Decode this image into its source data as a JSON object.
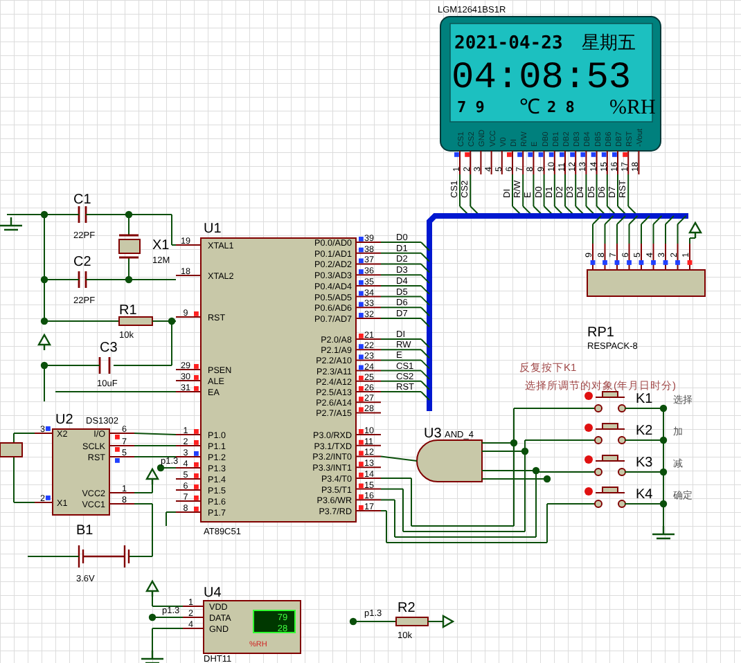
{
  "lcd": {
    "ref": "LGM12641BS1R",
    "date": "2021-04-23",
    "weekday": "星期五",
    "time": "04:08:53",
    "humidity": "7 9",
    "temperature_unit": "℃",
    "temperature": "2 8",
    "humidity_unit": "%RH",
    "pins": [
      {
        "number": "1",
        "name": "CS1",
        "net": "CS1",
        "high": false
      },
      {
        "number": "2",
        "name": "CS2",
        "net": "CS2",
        "high": true
      },
      {
        "number": "3",
        "name": "GND"
      },
      {
        "number": "4",
        "name": "VCC"
      },
      {
        "number": "5",
        "name": "V0"
      },
      {
        "number": "6",
        "name": "DI",
        "net": "DI",
        "high": true
      },
      {
        "number": "7",
        "name": "R/W",
        "net": "R/W",
        "high": false
      },
      {
        "number": "8",
        "name": "E",
        "net": "E",
        "high": false
      },
      {
        "number": "9",
        "name": "DB0",
        "net": "D0",
        "high": false
      },
      {
        "number": "10",
        "name": "DB1",
        "net": "D1",
        "high": false
      },
      {
        "number": "11",
        "name": "DB2",
        "net": "D2",
        "high": false
      },
      {
        "number": "12",
        "name": "DB3",
        "net": "D3",
        "high": false
      },
      {
        "number": "13",
        "name": "DB4",
        "net": "D4",
        "high": false
      },
      {
        "number": "14",
        "name": "DB5",
        "net": "D5",
        "high": false
      },
      {
        "number": "15",
        "name": "DB6",
        "net": "D6",
        "high": false
      },
      {
        "number": "16",
        "name": "DB7",
        "net": "D7",
        "high": false
      },
      {
        "number": "17",
        "name": "RST",
        "net": "RST",
        "high": true
      },
      {
        "number": "18",
        "name": "-Vout"
      }
    ]
  },
  "u1": {
    "ref": "U1",
    "part": "AT89C51",
    "left_pins": [
      {
        "number": "19",
        "name": "XTAL1"
      },
      {
        "number": "18",
        "name": "XTAL2"
      },
      {
        "number": "9",
        "name": "RST",
        "high": true
      },
      {
        "number": "29",
        "name": "PSEN",
        "high": true
      },
      {
        "number": "30",
        "name": "ALE",
        "high": true
      },
      {
        "number": "31",
        "name": "EA",
        "high": true
      },
      {
        "number": "1",
        "name": "P1.0",
        "high": true
      },
      {
        "number": "2",
        "name": "P1.1",
        "high": true
      },
      {
        "number": "3",
        "name": "P1.2",
        "high": false
      },
      {
        "number": "4",
        "name": "P1.3",
        "high": true
      },
      {
        "number": "5",
        "name": "P1.4",
        "high": true
      },
      {
        "number": "6",
        "name": "P1.5",
        "high": true
      },
      {
        "number": "7",
        "name": "P1.6",
        "high": true
      },
      {
        "number": "8",
        "name": "P1.7",
        "high": true
      }
    ],
    "right_pins": [
      {
        "number": "39",
        "name": "P0.0/AD0",
        "net": "D0",
        "high": false
      },
      {
        "number": "38",
        "name": "P0.1/AD1",
        "net": "D1",
        "high": false
      },
      {
        "number": "37",
        "name": "P0.2/AD2",
        "net": "D2",
        "high": false
      },
      {
        "number": "36",
        "name": "P0.3/AD3",
        "net": "D3",
        "high": false
      },
      {
        "number": "35",
        "name": "P0.4/AD4",
        "net": "D4",
        "high": false
      },
      {
        "number": "34",
        "name": "P0.5/AD5",
        "net": "D5",
        "high": false
      },
      {
        "number": "33",
        "name": "P0.6/AD6",
        "net": "D6",
        "high": false
      },
      {
        "number": "32",
        "name": "P0.7/AD7",
        "net": "D7",
        "high": false
      },
      {
        "number": "21",
        "name": "P2.0/A8",
        "net": "DI",
        "high": true
      },
      {
        "number": "22",
        "name": "P2.1/A9",
        "net": "RW",
        "high": false
      },
      {
        "number": "23",
        "name": "P2.2/A10",
        "net": "E",
        "high": false
      },
      {
        "number": "24",
        "name": "P2.3/A11",
        "net": "CS1",
        "high": false
      },
      {
        "number": "25",
        "name": "P2.4/A12",
        "net": "CS2",
        "high": true
      },
      {
        "number": "26",
        "name": "P2.5/A13",
        "net": "RST",
        "high": true
      },
      {
        "number": "27",
        "name": "P2.6/A14",
        "high": true
      },
      {
        "number": "28",
        "name": "P2.7/A15",
        "high": true
      },
      {
        "number": "10",
        "name": "P3.0/RXD",
        "high": true
      },
      {
        "number": "11",
        "name": "P3.1/TXD",
        "high": true
      },
      {
        "number": "12",
        "name": "P3.2/INT0",
        "high": true
      },
      {
        "number": "13",
        "name": "P3.3/INT1",
        "high": true
      },
      {
        "number": "14",
        "name": "P3.4/T0",
        "high": true
      },
      {
        "number": "15",
        "name": "P3.5/T1",
        "high": true
      },
      {
        "number": "16",
        "name": "P3.6/WR",
        "high": true
      },
      {
        "number": "17",
        "name": "P3.7/RD",
        "high": true
      }
    ],
    "net_label": "p1.3"
  },
  "c1": {
    "ref": "C1",
    "value": "22PF"
  },
  "c2": {
    "ref": "C2",
    "value": "22PF"
  },
  "x1": {
    "ref": "X1",
    "value": "12M"
  },
  "r1": {
    "ref": "R1",
    "value": "10k"
  },
  "c3": {
    "ref": "C3",
    "value": "10uF"
  },
  "u2": {
    "ref": "U2",
    "part": "DS1302",
    "pins": [
      {
        "number": "3",
        "name": "X2",
        "high": false
      },
      {
        "number": "2",
        "name": "X1",
        "high": false
      },
      {
        "number": "6",
        "name": "I/O",
        "high": true
      },
      {
        "number": "7",
        "name": "SCLK",
        "high": true
      },
      {
        "number": "5",
        "name": "RST",
        "high": false
      },
      {
        "number": "1",
        "name": "VCC2"
      },
      {
        "number": "8",
        "name": "VCC1"
      }
    ]
  },
  "b1": {
    "ref": "B1",
    "value": "3.6V"
  },
  "rp1": {
    "ref": "RP1",
    "part": "RESPACK-8",
    "pins": [
      {
        "number": "9",
        "high": false
      },
      {
        "number": "8",
        "high": false
      },
      {
        "number": "7",
        "high": false
      },
      {
        "number": "6",
        "high": false
      },
      {
        "number": "5",
        "high": false
      },
      {
        "number": "4",
        "high": false
      },
      {
        "number": "3",
        "high": false
      },
      {
        "number": "2",
        "high": false
      },
      {
        "number": "1",
        "high": true
      }
    ]
  },
  "u3": {
    "ref": "U3",
    "part": "AND_4"
  },
  "note": [
    "反复按下K1",
    "选择所调节的对象(年月日时分)"
  ],
  "keys": [
    {
      "ref": "K1",
      "label": "选择"
    },
    {
      "ref": "K2",
      "label": "加"
    },
    {
      "ref": "K3",
      "label": "减"
    },
    {
      "ref": "K4",
      "label": "确定"
    }
  ],
  "u4": {
    "ref": "U4",
    "part": "DHT11",
    "humidity": "79",
    "temperature": "28",
    "unit": "%RH",
    "net_label": "p1.3",
    "pins": [
      {
        "number": "1",
        "name": "VDD"
      },
      {
        "number": "2",
        "name": "DATA"
      },
      {
        "number": "4",
        "name": "GND"
      }
    ]
  },
  "r2": {
    "ref": "R2",
    "value": "10k",
    "net_label": "p1.3"
  }
}
